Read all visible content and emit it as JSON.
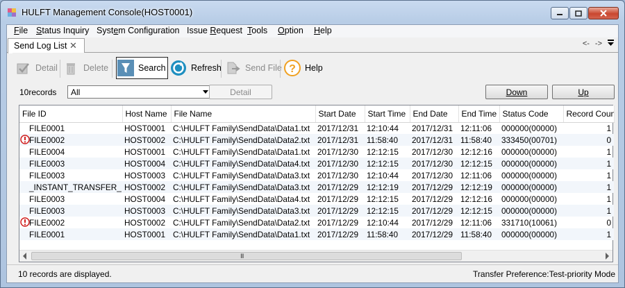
{
  "window": {
    "title": "HULFT Management Console(HOST0001)"
  },
  "menu": [
    {
      "prefix": "",
      "accel": "F",
      "rest": "ile"
    },
    {
      "prefix": "",
      "accel": "S",
      "rest": "tatus Inquiry"
    },
    {
      "prefix": "Syst",
      "accel": "e",
      "rest": "m Configuration"
    },
    {
      "prefix": "Issue ",
      "accel": "R",
      "rest": "equest"
    },
    {
      "prefix": "",
      "accel": "T",
      "rest": "ools"
    },
    {
      "prefix": "",
      "accel": "O",
      "rest": "ption"
    },
    {
      "prefix": "",
      "accel": "H",
      "rest": "elp"
    }
  ],
  "tab": {
    "label": "Send Log List",
    "close": "✕",
    "nav_back": "<-",
    "nav_forward": "->"
  },
  "toolbar": {
    "detail": "Detail",
    "delete": "Delete",
    "search": "Search",
    "refresh": "Refresh",
    "send_file": "Send File",
    "help": "Help"
  },
  "filter": {
    "records_label": "10records",
    "selected": "All",
    "detail_button": "Detail",
    "down_button": "Down",
    "up_button": "Up"
  },
  "table": {
    "columns": [
      "File ID",
      "Host Name",
      "File Name",
      "Start Date",
      "Start Time",
      "End Date",
      "End Time",
      "Status Code",
      "Record Count"
    ],
    "rows": [
      {
        "error": false,
        "cells": [
          "FILE0001",
          "HOST0001",
          "C:\\HULFT Family\\SendData\\Data1.txt",
          "2017/12/31",
          "12:10:44",
          "2017/12/31",
          "12:11:06",
          "000000(00000)",
          "1"
        ]
      },
      {
        "error": true,
        "cells": [
          "FILE0002",
          "HOST0002",
          "C:\\HULFT Family\\SendData\\Data2.txt",
          "2017/12/31",
          "11:58:40",
          "2017/12/31",
          "11:58:40",
          "333450(00701)",
          "0"
        ]
      },
      {
        "error": false,
        "cells": [
          "FILE0004",
          "HOST0001",
          "C:\\HULFT Family\\SendData\\Data1.txt",
          "2017/12/30",
          "12:12:15",
          "2017/12/30",
          "12:12:16",
          "000000(00000)",
          "1"
        ]
      },
      {
        "error": false,
        "cells": [
          "FILE0003",
          "HOST0004",
          "C:\\HULFT Family\\SendData\\Data4.txt",
          "2017/12/30",
          "12:12:15",
          "2017/12/30",
          "12:12:15",
          "000000(00000)",
          "1"
        ]
      },
      {
        "error": false,
        "cells": [
          "FILE0003",
          "HOST0003",
          "C:\\HULFT Family\\SendData\\Data3.txt",
          "2017/12/30",
          "12:10:44",
          "2017/12/30",
          "12:11:06",
          "000000(00000)",
          "1"
        ]
      },
      {
        "error": false,
        "cells": [
          "_INSTANT_TRANSFER_",
          "HOST0002",
          "C:\\HULFT Family\\SendData\\Data3.txt",
          "2017/12/29",
          "12:12:19",
          "2017/12/29",
          "12:12:19",
          "000000(00000)",
          "1"
        ]
      },
      {
        "error": false,
        "cells": [
          "FILE0003",
          "HOST0004",
          "C:\\HULFT Family\\SendData\\Data4.txt",
          "2017/12/29",
          "12:12:15",
          "2017/12/29",
          "12:12:16",
          "000000(00000)",
          "1"
        ]
      },
      {
        "error": false,
        "cells": [
          "FILE0003",
          "HOST0003",
          "C:\\HULFT Family\\SendData\\Data3.txt",
          "2017/12/29",
          "12:12:15",
          "2017/12/29",
          "12:12:15",
          "000000(00000)",
          "1"
        ]
      },
      {
        "error": true,
        "cells": [
          "FILE0002",
          "HOST0002",
          "C:\\HULFT Family\\SendData\\Data2.txt",
          "2017/12/29",
          "12:10:44",
          "2017/12/29",
          "12:11:06",
          "331710(10061)",
          "0"
        ]
      },
      {
        "error": false,
        "cells": [
          "FILE0001",
          "HOST0001",
          "C:\\HULFT Family\\SendData\\Data1.txt",
          "2017/12/29",
          "11:58:40",
          "2017/12/29",
          "11:58:40",
          "000000(00000)",
          "1"
        ]
      }
    ],
    "scroll_grip": "III"
  },
  "status": {
    "left": "10 records are displayed.",
    "right": "Transfer Preference:Test-priority Mode"
  },
  "colors": {
    "search_icon_bg": "#5a8fb6",
    "refresh_icon": "#1e8fc0",
    "help_icon": "#f0a020",
    "error_icon": "#d02020"
  }
}
